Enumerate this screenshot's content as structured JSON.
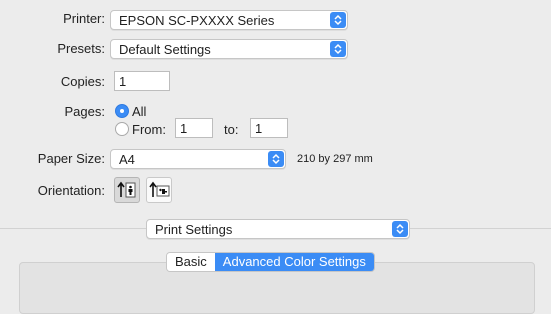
{
  "printer": {
    "label": "Printer:",
    "value": "EPSON SC-PXXXX Series"
  },
  "presets": {
    "label": "Presets:",
    "value": "Default Settings"
  },
  "copies": {
    "label": "Copies:",
    "value": "1"
  },
  "pages": {
    "label": "Pages:",
    "all_label": "All",
    "from_label": "From:",
    "from_value": "1",
    "to_label": "to:",
    "to_value": "1",
    "selected": "All"
  },
  "paper_size": {
    "label": "Paper Size:",
    "value": "A4",
    "dimensions": "210 by 297 mm"
  },
  "orientation": {
    "label": "Orientation:",
    "options": [
      "portrait-icon",
      "landscape-icon"
    ],
    "selected": "portrait"
  },
  "section": {
    "value": "Print Settings"
  },
  "tabs": {
    "items": [
      "Basic",
      "Advanced Color Settings"
    ],
    "selected": "Advanced Color Settings"
  },
  "colors": {
    "accent": "#3b8cf5",
    "background": "#ececec"
  }
}
